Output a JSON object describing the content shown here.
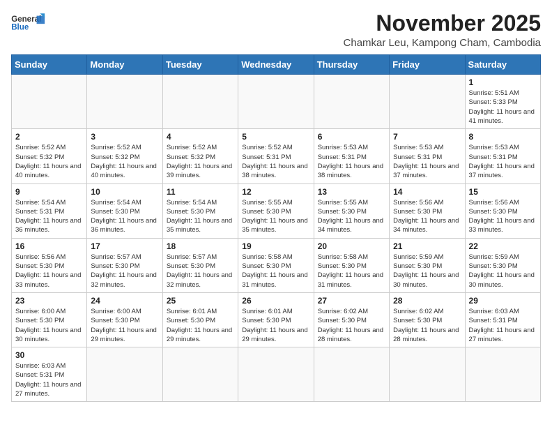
{
  "header": {
    "logo_general": "General",
    "logo_blue": "Blue",
    "month_title": "November 2025",
    "subtitle": "Chamkar Leu, Kampong Cham, Cambodia"
  },
  "weekdays": [
    "Sunday",
    "Monday",
    "Tuesday",
    "Wednesday",
    "Thursday",
    "Friday",
    "Saturday"
  ],
  "days": [
    {
      "date": null,
      "number": "",
      "sunrise": "",
      "sunset": "",
      "daylight": ""
    },
    {
      "date": null,
      "number": "",
      "sunrise": "",
      "sunset": "",
      "daylight": ""
    },
    {
      "date": null,
      "number": "",
      "sunrise": "",
      "sunset": "",
      "daylight": ""
    },
    {
      "date": null,
      "number": "",
      "sunrise": "",
      "sunset": "",
      "daylight": ""
    },
    {
      "date": null,
      "number": "",
      "sunrise": "",
      "sunset": "",
      "daylight": ""
    },
    {
      "date": null,
      "number": "",
      "sunrise": "",
      "sunset": "",
      "daylight": ""
    },
    {
      "date": 1,
      "number": "1",
      "sunrise": "Sunrise: 5:51 AM",
      "sunset": "Sunset: 5:33 PM",
      "daylight": "Daylight: 11 hours and 41 minutes."
    },
    {
      "date": 2,
      "number": "2",
      "sunrise": "Sunrise: 5:52 AM",
      "sunset": "Sunset: 5:32 PM",
      "daylight": "Daylight: 11 hours and 40 minutes."
    },
    {
      "date": 3,
      "number": "3",
      "sunrise": "Sunrise: 5:52 AM",
      "sunset": "Sunset: 5:32 PM",
      "daylight": "Daylight: 11 hours and 40 minutes."
    },
    {
      "date": 4,
      "number": "4",
      "sunrise": "Sunrise: 5:52 AM",
      "sunset": "Sunset: 5:32 PM",
      "daylight": "Daylight: 11 hours and 39 minutes."
    },
    {
      "date": 5,
      "number": "5",
      "sunrise": "Sunrise: 5:52 AM",
      "sunset": "Sunset: 5:31 PM",
      "daylight": "Daylight: 11 hours and 38 minutes."
    },
    {
      "date": 6,
      "number": "6",
      "sunrise": "Sunrise: 5:53 AM",
      "sunset": "Sunset: 5:31 PM",
      "daylight": "Daylight: 11 hours and 38 minutes."
    },
    {
      "date": 7,
      "number": "7",
      "sunrise": "Sunrise: 5:53 AM",
      "sunset": "Sunset: 5:31 PM",
      "daylight": "Daylight: 11 hours and 37 minutes."
    },
    {
      "date": 8,
      "number": "8",
      "sunrise": "Sunrise: 5:53 AM",
      "sunset": "Sunset: 5:31 PM",
      "daylight": "Daylight: 11 hours and 37 minutes."
    },
    {
      "date": 9,
      "number": "9",
      "sunrise": "Sunrise: 5:54 AM",
      "sunset": "Sunset: 5:31 PM",
      "daylight": "Daylight: 11 hours and 36 minutes."
    },
    {
      "date": 10,
      "number": "10",
      "sunrise": "Sunrise: 5:54 AM",
      "sunset": "Sunset: 5:30 PM",
      "daylight": "Daylight: 11 hours and 36 minutes."
    },
    {
      "date": 11,
      "number": "11",
      "sunrise": "Sunrise: 5:54 AM",
      "sunset": "Sunset: 5:30 PM",
      "daylight": "Daylight: 11 hours and 35 minutes."
    },
    {
      "date": 12,
      "number": "12",
      "sunrise": "Sunrise: 5:55 AM",
      "sunset": "Sunset: 5:30 PM",
      "daylight": "Daylight: 11 hours and 35 minutes."
    },
    {
      "date": 13,
      "number": "13",
      "sunrise": "Sunrise: 5:55 AM",
      "sunset": "Sunset: 5:30 PM",
      "daylight": "Daylight: 11 hours and 34 minutes."
    },
    {
      "date": 14,
      "number": "14",
      "sunrise": "Sunrise: 5:56 AM",
      "sunset": "Sunset: 5:30 PM",
      "daylight": "Daylight: 11 hours and 34 minutes."
    },
    {
      "date": 15,
      "number": "15",
      "sunrise": "Sunrise: 5:56 AM",
      "sunset": "Sunset: 5:30 PM",
      "daylight": "Daylight: 11 hours and 33 minutes."
    },
    {
      "date": 16,
      "number": "16",
      "sunrise": "Sunrise: 5:56 AM",
      "sunset": "Sunset: 5:30 PM",
      "daylight": "Daylight: 11 hours and 33 minutes."
    },
    {
      "date": 17,
      "number": "17",
      "sunrise": "Sunrise: 5:57 AM",
      "sunset": "Sunset: 5:30 PM",
      "daylight": "Daylight: 11 hours and 32 minutes."
    },
    {
      "date": 18,
      "number": "18",
      "sunrise": "Sunrise: 5:57 AM",
      "sunset": "Sunset: 5:30 PM",
      "daylight": "Daylight: 11 hours and 32 minutes."
    },
    {
      "date": 19,
      "number": "19",
      "sunrise": "Sunrise: 5:58 AM",
      "sunset": "Sunset: 5:30 PM",
      "daylight": "Daylight: 11 hours and 31 minutes."
    },
    {
      "date": 20,
      "number": "20",
      "sunrise": "Sunrise: 5:58 AM",
      "sunset": "Sunset: 5:30 PM",
      "daylight": "Daylight: 11 hours and 31 minutes."
    },
    {
      "date": 21,
      "number": "21",
      "sunrise": "Sunrise: 5:59 AM",
      "sunset": "Sunset: 5:30 PM",
      "daylight": "Daylight: 11 hours and 30 minutes."
    },
    {
      "date": 22,
      "number": "22",
      "sunrise": "Sunrise: 5:59 AM",
      "sunset": "Sunset: 5:30 PM",
      "daylight": "Daylight: 11 hours and 30 minutes."
    },
    {
      "date": 23,
      "number": "23",
      "sunrise": "Sunrise: 6:00 AM",
      "sunset": "Sunset: 5:30 PM",
      "daylight": "Daylight: 11 hours and 30 minutes."
    },
    {
      "date": 24,
      "number": "24",
      "sunrise": "Sunrise: 6:00 AM",
      "sunset": "Sunset: 5:30 PM",
      "daylight": "Daylight: 11 hours and 29 minutes."
    },
    {
      "date": 25,
      "number": "25",
      "sunrise": "Sunrise: 6:01 AM",
      "sunset": "Sunset: 5:30 PM",
      "daylight": "Daylight: 11 hours and 29 minutes."
    },
    {
      "date": 26,
      "number": "26",
      "sunrise": "Sunrise: 6:01 AM",
      "sunset": "Sunset: 5:30 PM",
      "daylight": "Daylight: 11 hours and 29 minutes."
    },
    {
      "date": 27,
      "number": "27",
      "sunrise": "Sunrise: 6:02 AM",
      "sunset": "Sunset: 5:30 PM",
      "daylight": "Daylight: 11 hours and 28 minutes."
    },
    {
      "date": 28,
      "number": "28",
      "sunrise": "Sunrise: 6:02 AM",
      "sunset": "Sunset: 5:30 PM",
      "daylight": "Daylight: 11 hours and 28 minutes."
    },
    {
      "date": 29,
      "number": "29",
      "sunrise": "Sunrise: 6:03 AM",
      "sunset": "Sunset: 5:31 PM",
      "daylight": "Daylight: 11 hours and 27 minutes."
    },
    {
      "date": 30,
      "number": "30",
      "sunrise": "Sunrise: 6:03 AM",
      "sunset": "Sunset: 5:31 PM",
      "daylight": "Daylight: 11 hours and 27 minutes."
    },
    {
      "date": null,
      "number": "",
      "sunrise": "",
      "sunset": "",
      "daylight": ""
    },
    {
      "date": null,
      "number": "",
      "sunrise": "",
      "sunset": "",
      "daylight": ""
    },
    {
      "date": null,
      "number": "",
      "sunrise": "",
      "sunset": "",
      "daylight": ""
    },
    {
      "date": null,
      "number": "",
      "sunrise": "",
      "sunset": "",
      "daylight": ""
    },
    {
      "date": null,
      "number": "",
      "sunrise": "",
      "sunset": "",
      "daylight": ""
    },
    {
      "date": null,
      "number": "",
      "sunrise": "",
      "sunset": "",
      "daylight": ""
    }
  ]
}
